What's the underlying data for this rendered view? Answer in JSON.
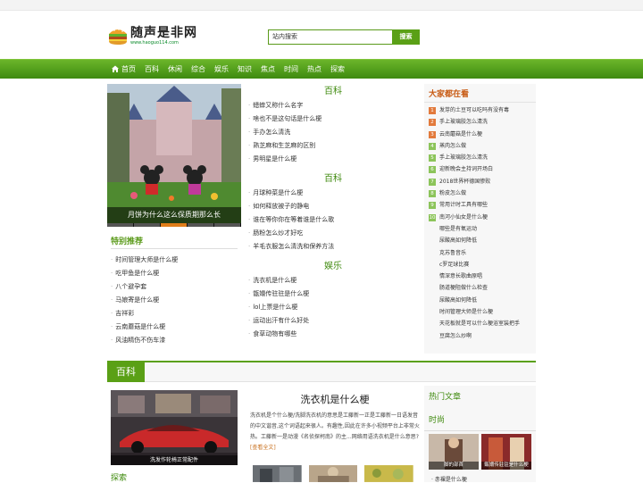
{
  "site": {
    "name": "随声是非网",
    "url": "www.haoguo114.com"
  },
  "search": {
    "placeholder": "站内搜索",
    "button": "搜索"
  },
  "nav": [
    "首页",
    "百科",
    "休闲",
    "综合",
    "娱乐",
    "知识",
    "焦点",
    "时间",
    "热点",
    "探索"
  ],
  "slider": {
    "caption": "月饼为什么这么保质期那么长",
    "dots": 5,
    "active": 2
  },
  "tese": {
    "title": "特别推荐",
    "items": [
      "时间管理大师是什么梗",
      "吃甲鱼是什么梗",
      "八个避孕套",
      "马娘寄是什么梗",
      "吉祥彩",
      "云南蘑菇是什么梗",
      "风油精伤不伤车漆"
    ]
  },
  "mid": [
    {
      "title": "百科",
      "items": [
        "蟋蟀又称什么名字",
        "啥也不是这句话是什么梗",
        "手办怎么清洗",
        "熟芝麻和生芝麻的区别",
        "男明星是什么梗"
      ]
    },
    {
      "title": "百科",
      "items": [
        "月球种菜是什么梗",
        "如何释放被子的静电",
        "谁在等你你在等着谁是什么歌",
        "肠粉怎么炒才好吃",
        "羊毛衣服怎么清洗和保养方法"
      ]
    },
    {
      "title": "娱乐",
      "items": [
        "洗衣机是什么梗",
        "甑嬛传驻驻是什么梗",
        "lol上票是什么梗",
        "运动出汗有什么好处",
        "食草动物有哪些"
      ]
    }
  ],
  "hot": {
    "title": "大家都在看",
    "items": [
      {
        "n": "1",
        "t": "发芽的土豆可以吃吗有没有毒"
      },
      {
        "n": "2",
        "t": "手上玻璃胶怎么清洗"
      },
      {
        "n": "3",
        "t": "云南蘑菇是什么梗"
      },
      {
        "n": "4",
        "t": "蒸肉怎么做"
      },
      {
        "n": "5",
        "t": "手上玻璃胶怎么清洗"
      },
      {
        "n": "6",
        "t": "迎新晚会主持词开场白"
      },
      {
        "n": "7",
        "t": "2018世界杯德国惨败"
      },
      {
        "n": "8",
        "t": "粉皮怎么做"
      },
      {
        "n": "9",
        "t": "常用计时工具有哪些"
      },
      {
        "n": "10",
        "t": "南河小仙女是什么梗"
      },
      {
        "n": "",
        "t": "哪些是有氧运动"
      },
      {
        "n": "",
        "t": "尿酸高如何降低"
      },
      {
        "n": "",
        "t": "克苏鲁音乐"
      },
      {
        "n": "",
        "t": "c罗足球比赛"
      },
      {
        "n": "",
        "t": "情深意长歌曲原唱"
      },
      {
        "n": "",
        "t": "肠道梗阻做什么检查"
      },
      {
        "n": "",
        "t": "尿酸高如何降低"
      },
      {
        "n": "",
        "t": "时间管理大师是什么梗"
      },
      {
        "n": "",
        "t": "天花板就是可以什么梗浴室装把手"
      },
      {
        "n": "",
        "t": "豆腐怎么炒啊"
      }
    ]
  },
  "band": {
    "title": "百科"
  },
  "pic2": {
    "caption": "洗发作轮椅正常配件"
  },
  "tansuo": "探索",
  "article": {
    "title": "洗衣机是什么梗",
    "body": "洗衣机是个什么梗/洗脚洗衣机的意思是工藤新一正是工藤新一日语发音的中文谐音,这个词语起来很人。有趣性,因此在许多小视频平台上非常火热。工藤新一是动漫《名侦探柯南》的主...网络用语洗衣机是什么意思?",
    "more": "[查看全文]"
  },
  "r2": {
    "title1": "热门文章",
    "title2": "时尚",
    "cap1": "脚的部首",
    "cap2": "甑嬛传驻驻是什么梗",
    "item": "· 赤裸是什么梗"
  }
}
